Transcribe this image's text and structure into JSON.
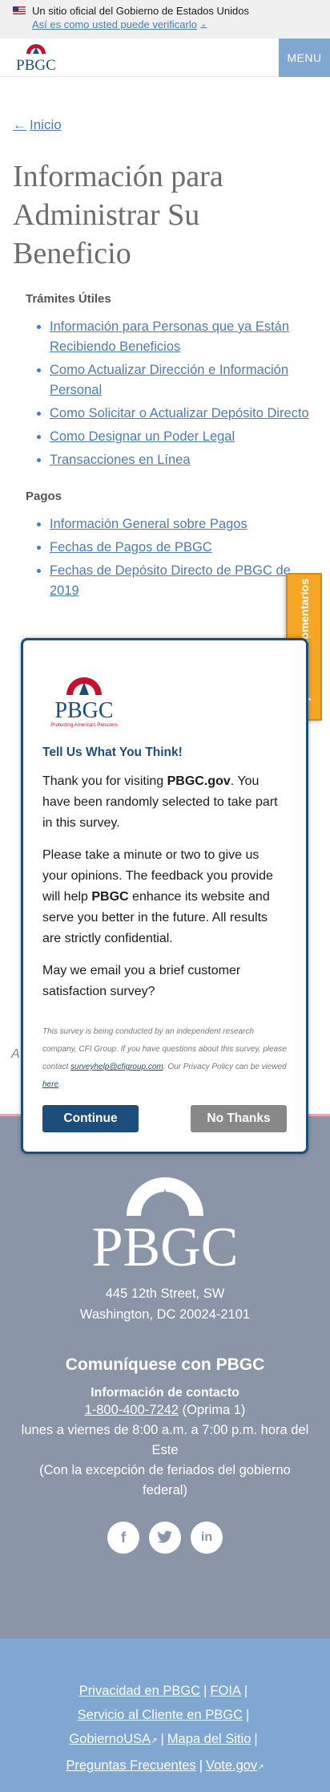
{
  "gov_banner": {
    "official_text": "Un sitio oficial del Gobierno de Estados Unidos",
    "verify_link": "Así es como usted puede verificarlo"
  },
  "header": {
    "logo_text": "PBGC",
    "menu_label": "MENU"
  },
  "main": {
    "back_link": "Inicio",
    "title": "Información para Administrar Su Beneficio",
    "sections": [
      {
        "title": "Trámites Útiles",
        "links": [
          "Información para Personas que ya Están Recibiendo Beneficios",
          "Como Actualizar Dirección e Información Personal",
          "Como Solicitar o Actualizar Depósito Directo",
          "Como Designar un Poder Legal",
          "Transacciones en Línea"
        ]
      },
      {
        "title": "Pagos",
        "links": [
          "Información General sobre Pagos",
          "Fechas de Pagos de PBGC",
          "Fechas de Depósito Directo de PBGC de 2019"
        ]
      }
    ],
    "partial_letter": "A"
  },
  "feedback_tab": {
    "label": "Déjenos sus comentarios"
  },
  "survey": {
    "logo_text": "PBGC",
    "logo_tagline": "Protecting America's Pensions",
    "heading": "Tell Us What You Think!",
    "p1_a": "Thank you for visiting ",
    "p1_b": "PBGC.gov",
    "p1_c": ". You have been randomly selected to take part in this survey.",
    "p2_a": "Please take a minute or two to give us your opinions. The feedback you provide will help ",
    "p2_b": "PBGC",
    "p2_c": " enhance its website and serve you better in the future. All results are strictly confidential.",
    "p3": "May we email you a brief customer satisfaction survey?",
    "fine_a": "This survey is being conducted by an independent research company, CFI Group. If you have questions about this survey, please contact ",
    "fine_email": "surveyhelp@cfigroup.com",
    "fine_b": ". Our Privacy Policy can be viewed ",
    "fine_here": "here",
    "fine_c": ".",
    "continue_label": "Continue",
    "no_thanks_label": "No Thanks"
  },
  "footer": {
    "logo_text": "PBGC",
    "address_line1": "445 12th Street, SW",
    "address_line2": "Washington, DC 20024-2101",
    "contact_title": "Comuníquese con PBGC",
    "contact_subtitle": "Información de contacto",
    "phone": "1-800-400-7242",
    "phone_option": " (Oprima 1)",
    "hours": "lunes a viernes de 8:00 a.m. a 7:00 p.m. hora del Este",
    "holidays": "(Con la excepción de feriados del gobierno federal)",
    "social_icons": [
      "facebook-icon",
      "twitter-icon",
      "linkedin-icon"
    ],
    "bottom_links": {
      "privacy": "Privacidad en PBGC",
      "foia": "FOIA",
      "customer_service": "Servicio al Cliente en PBGC",
      "usagov": "GobiernoUSA",
      "sitemap": "Mapa del Sitio",
      "faq": "Preguntas Frecuentes",
      "vote": "Vote.gov"
    }
  },
  "colors": {
    "link": "#4a7bb8",
    "menu_bg": "#7fa7d1",
    "footer_top": "#8a95a8",
    "footer_bottom": "#7fa7d1",
    "survey_accent": "#1d4d7a",
    "feedback_tab": "#f5a623"
  }
}
